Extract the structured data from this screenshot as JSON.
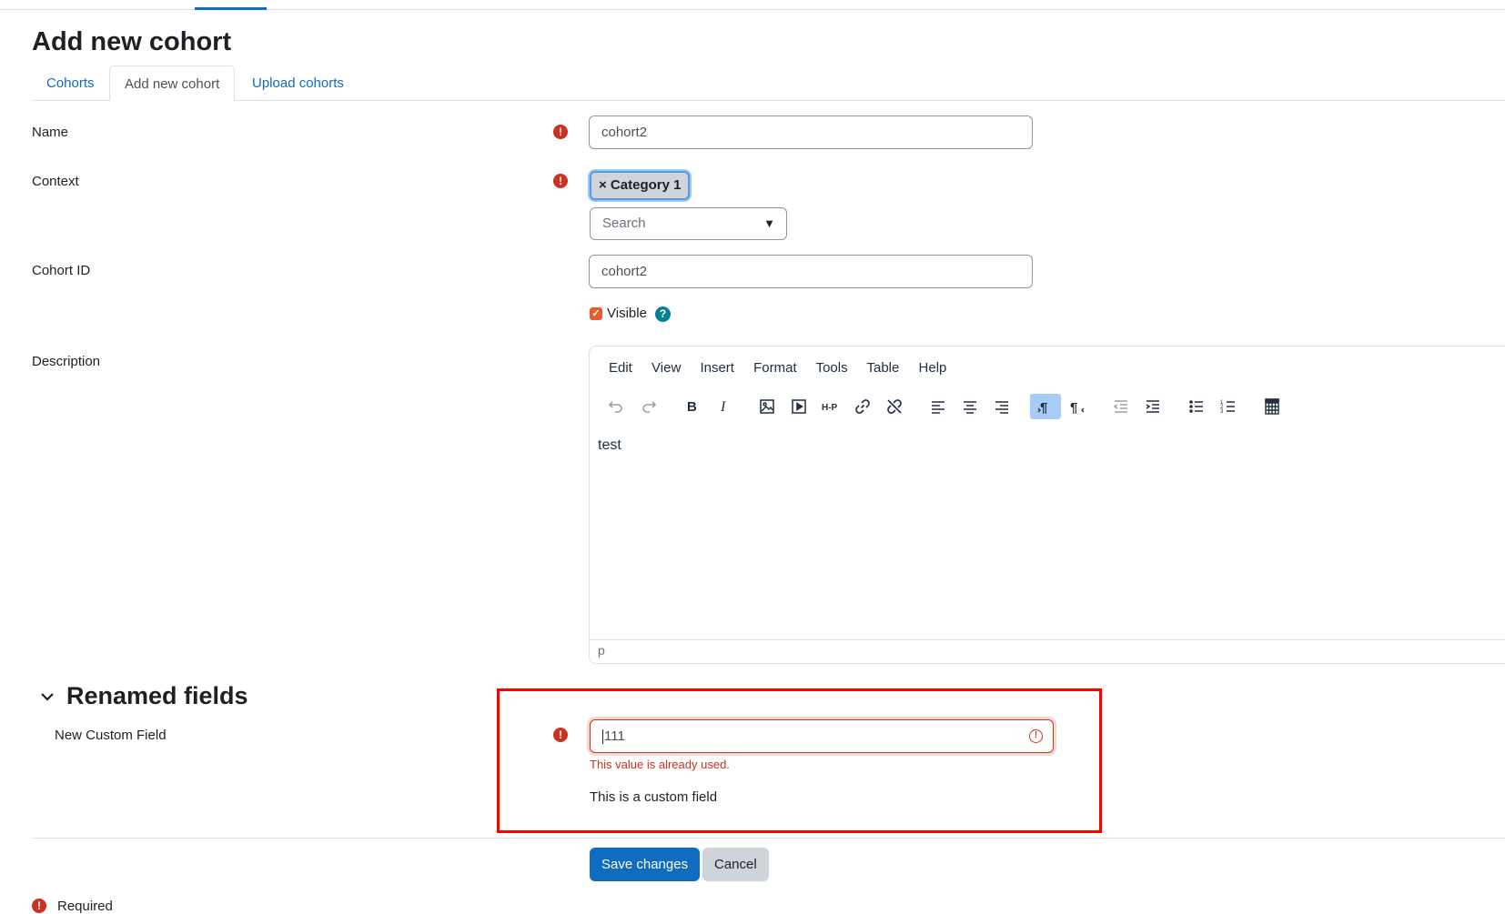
{
  "page": {
    "title": "Add new cohort"
  },
  "tabs": [
    {
      "label": "Cohorts",
      "active": false
    },
    {
      "label": "Add new cohort",
      "active": true
    },
    {
      "label": "Upload cohorts",
      "active": false
    }
  ],
  "form": {
    "name": {
      "label": "Name",
      "value": "cohort2",
      "required": true
    },
    "context": {
      "label": "Context",
      "selected_chip": "× Category 1",
      "search_placeholder": "Search",
      "caret": "▼",
      "required": true
    },
    "cohort_id": {
      "label": "Cohort ID",
      "value": "cohort2"
    },
    "visible": {
      "label": "Visible",
      "checked": true
    },
    "description": {
      "label": "Description",
      "menu": [
        "Edit",
        "View",
        "Insert",
        "Format",
        "Tools",
        "Table",
        "Help"
      ],
      "content": "test",
      "status_path": "p",
      "toolbar_icons": [
        "undo-icon",
        "redo-icon",
        "bold-icon",
        "italic-icon",
        "image-icon",
        "media-icon",
        "h5p-icon",
        "link-icon",
        "unlink-icon",
        "align-left-icon",
        "align-center-icon",
        "align-right-icon",
        "ltr-icon",
        "rtl-icon",
        "outdent-icon",
        "indent-icon",
        "bullet-list-icon",
        "numbered-list-icon",
        "calculator-icon"
      ]
    }
  },
  "section": {
    "title": "Renamed fields",
    "custom_field": {
      "label": "New Custom Field",
      "value": "111",
      "error": "This value is already used.",
      "help": "This is a custom field",
      "required": true
    }
  },
  "buttons": {
    "save": "Save changes",
    "cancel": "Cancel"
  },
  "legend": {
    "required": "Required"
  },
  "colors": {
    "primary": "#0f6cbf",
    "danger": "#ca3120",
    "highlight": "#ff0000",
    "checkbox": "#e8592b",
    "help": "#008196"
  }
}
